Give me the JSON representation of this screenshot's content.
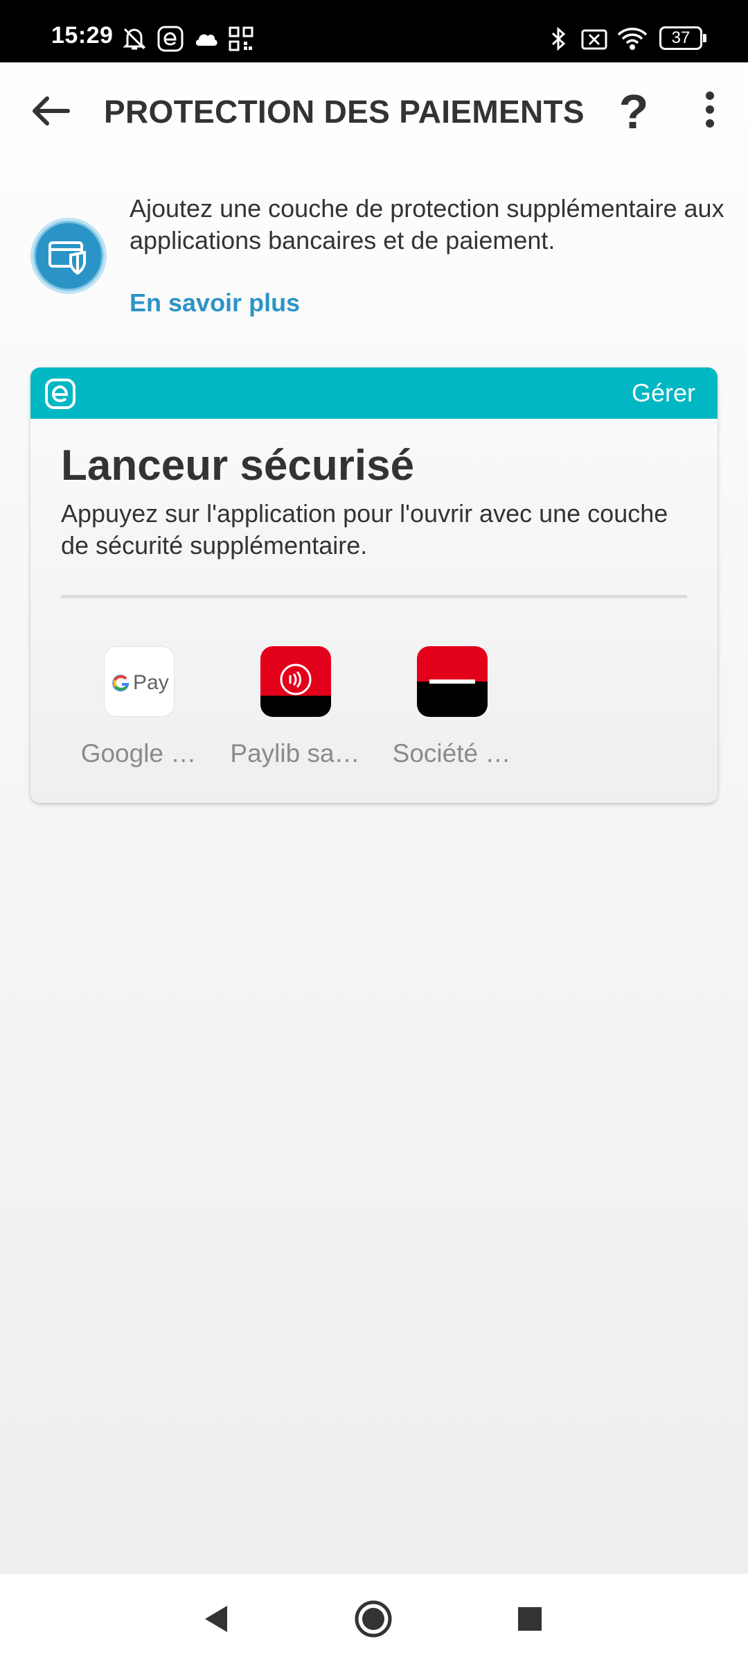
{
  "status_bar": {
    "time": "15:29",
    "battery": "37",
    "left_icons": [
      "notifications-off-icon",
      "eset-icon",
      "cloud-icon",
      "qr-code-icon"
    ],
    "right_icons": [
      "bluetooth-icon",
      "sim-off-icon",
      "wifi-icon",
      "battery-icon"
    ]
  },
  "header": {
    "title": "PROTECTION DES PAIEMENTS",
    "help_label": "?"
  },
  "intro": {
    "text": "Ajoutez une couche de protection supplémentaire aux applications bancaires et de paiement.",
    "learn_more": "En savoir plus"
  },
  "card": {
    "manage_label": "Gérer",
    "title": "Lanceur sécurisé",
    "description": "Appuyez sur l'application pour l'ouvrir avec une couche de sécurité supplémentaire.",
    "apps": [
      {
        "label": "Google …",
        "icon": "google-pay-icon"
      },
      {
        "label": "Paylib sa…",
        "icon": "paylib-icon"
      },
      {
        "label": "Société …",
        "icon": "societe-generale-icon"
      }
    ]
  },
  "gpay_icon_text": "Pay",
  "colors": {
    "accent": "#00b7c3",
    "link": "#2b94c6",
    "brand_red": "#e3001b"
  }
}
